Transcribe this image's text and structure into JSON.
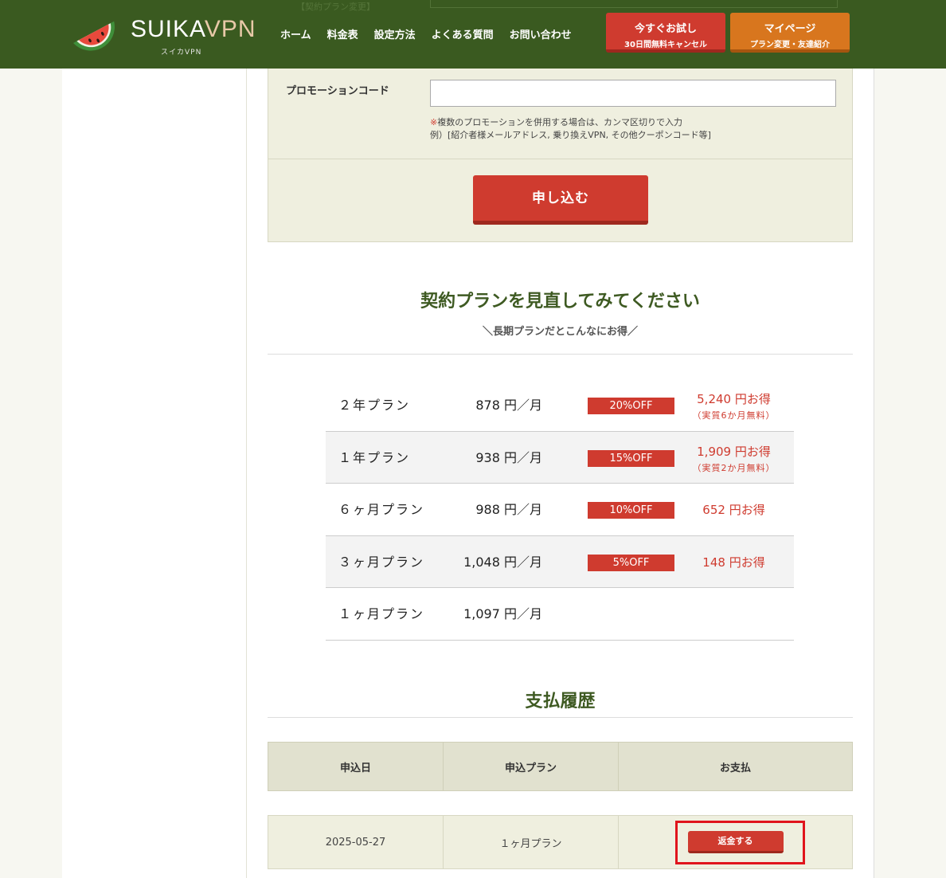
{
  "header": {
    "logo_text_main": "SUIKA",
    "logo_text_accent": "VPN",
    "logo_sub": "スイカVPN",
    "nav": [
      "ホーム",
      "料金表",
      "設定方法",
      "よくある質問",
      "お問い合わせ"
    ],
    "trial_button": {
      "line1": "今すぐお試し",
      "line2": "30日間無料キャンセル"
    },
    "mypage_button": {
      "line1": "マイページ",
      "line2": "プラン変更・友達紹介"
    },
    "ghost_text": "【契約プラン変更】"
  },
  "form": {
    "promo_label": "プロモーションコード",
    "promo_value": "",
    "note_mark": "※",
    "note_line1": "複数のプロモーションを併用する場合は、カンマ区切りで入力",
    "note_line2": "例）[紹介者様メールアドレス, 乗り換えVPN, その他クーポンコード等]",
    "submit_label": "申し込む"
  },
  "plans": {
    "title": "契約プランを見直してみてください",
    "subtitle": "＼長期プランだとこんなにお得／",
    "rows": [
      {
        "name": "２年プラン",
        "price": "878 円／月",
        "badge": "20%OFF",
        "save": "5,240 円お得",
        "save_note": "（実質6か月無料）"
      },
      {
        "name": "１年プラン",
        "price": "938 円／月",
        "badge": "15%OFF",
        "save": "1,909 円お得",
        "save_note": "（実質2か月無料）"
      },
      {
        "name": "６ヶ月プラン",
        "price": "988 円／月",
        "badge": "10%OFF",
        "save": "652 円お得",
        "save_note": ""
      },
      {
        "name": "３ヶ月プラン",
        "price": "1,048 円／月",
        "badge": "5%OFF",
        "save": "148 円お得",
        "save_note": ""
      },
      {
        "name": "１ヶ月プラン",
        "price": "1,097 円／月",
        "badge": "",
        "save": "",
        "save_note": ""
      }
    ]
  },
  "payments": {
    "title": "支払履歴",
    "headers": [
      "申込日",
      "申込プラン",
      "お支払"
    ],
    "rows": [
      {
        "date": "2025-05-27",
        "plan": "１ヶ月プラン",
        "action": "返金する"
      }
    ]
  },
  "colors": {
    "header_bg": "#3a5a20",
    "accent_red": "#cf3b2f",
    "accent_orange": "#d8761e",
    "highlight": "#e0141c"
  }
}
